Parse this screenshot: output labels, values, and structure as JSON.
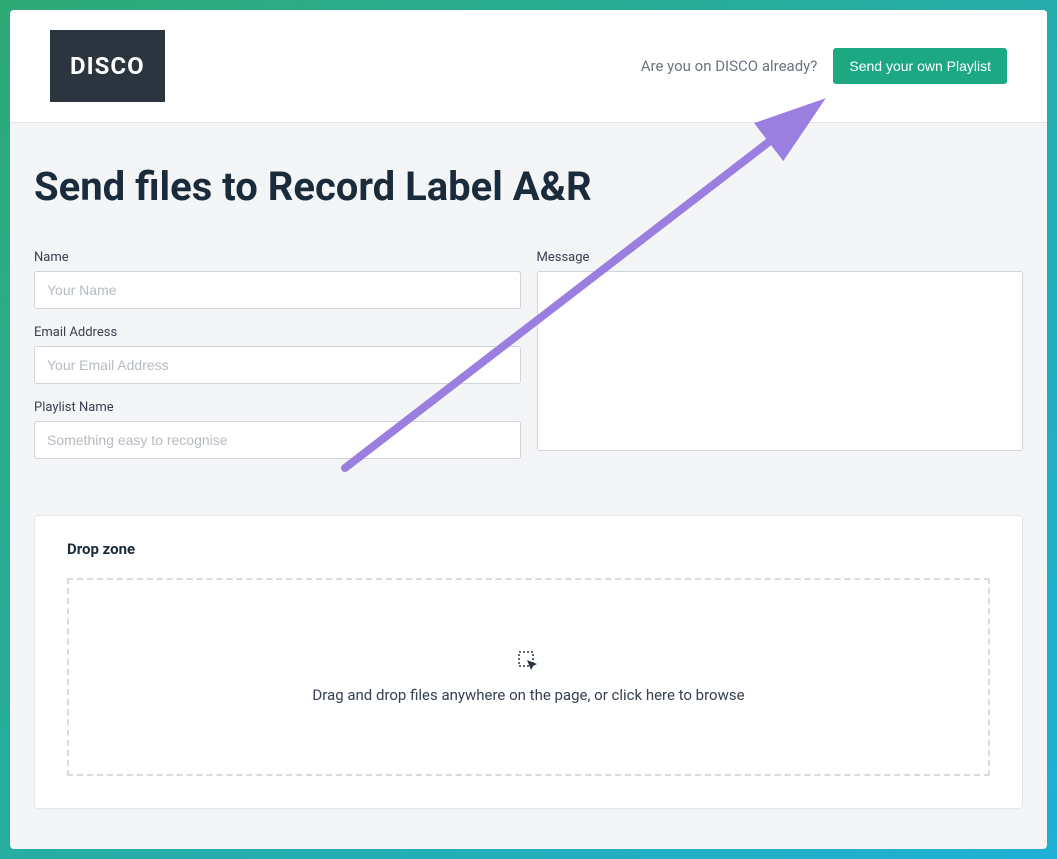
{
  "header": {
    "logo_text": "DISCO",
    "already_text": "Are you on DISCO already?",
    "send_playlist_button": "Send your own Playlist"
  },
  "page": {
    "title": "Send files to Record Label A&R"
  },
  "form": {
    "name": {
      "label": "Name",
      "placeholder": "Your Name",
      "value": ""
    },
    "email": {
      "label": "Email Address",
      "placeholder": "Your Email Address",
      "value": ""
    },
    "playlist": {
      "label": "Playlist Name",
      "placeholder": "Something easy to recognise",
      "value": ""
    },
    "message": {
      "label": "Message",
      "value": ""
    }
  },
  "dropzone": {
    "title": "Drop zone",
    "instruction": "Drag and drop files anywhere on the page, or click here to browse"
  },
  "colors": {
    "accent": "#1ca883",
    "annotation": "#9b7fe0"
  }
}
